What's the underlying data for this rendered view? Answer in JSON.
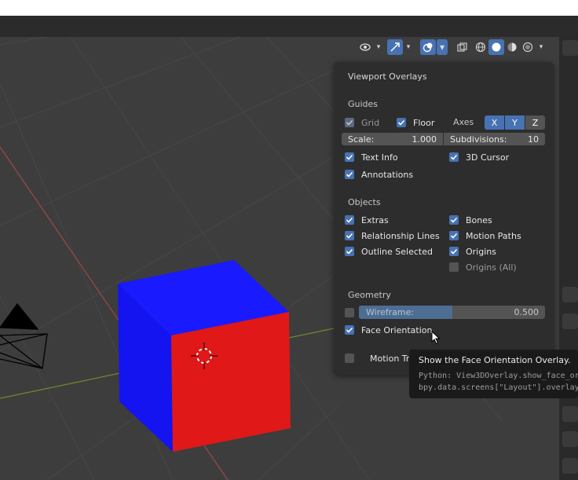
{
  "header": {
    "icons": [
      "eye-icon",
      "gizmo-icon",
      "overlays-icon",
      "xray-icon",
      "wireframe-shading-icon",
      "solid-shading-icon",
      "material-shading-icon",
      "rendered-shading-icon"
    ]
  },
  "panel": {
    "title": "Viewport Overlays",
    "guides": {
      "heading": "Guides",
      "grid": {
        "label": "Grid",
        "checked": true
      },
      "floor": {
        "label": "Floor",
        "checked": true
      },
      "axes_label": "Axes",
      "axes": [
        "X",
        "Y",
        "Z"
      ],
      "scale": {
        "label": "Scale:",
        "value": "1.000"
      },
      "subdivisions": {
        "label": "Subdivisions:",
        "value": "10"
      },
      "text_info": {
        "label": "Text Info",
        "checked": true
      },
      "cursor_3d": {
        "label": "3D Cursor",
        "checked": true
      },
      "annotations": {
        "label": "Annotations",
        "checked": true
      }
    },
    "objects": {
      "heading": "Objects",
      "extras": {
        "label": "Extras",
        "checked": true
      },
      "bones": {
        "label": "Bones",
        "checked": true
      },
      "relationship_lines": {
        "label": "Relationship Lines",
        "checked": true
      },
      "motion_paths": {
        "label": "Motion Paths",
        "checked": true
      },
      "outline_selected": {
        "label": "Outline Selected",
        "checked": true
      },
      "origins": {
        "label": "Origins",
        "checked": true
      },
      "origins_all": {
        "label": "Origins (All)",
        "checked": false
      }
    },
    "geometry": {
      "heading": "Geometry",
      "wireframe": {
        "label": "Wireframe:",
        "value": "0.500",
        "fraction": 0.5,
        "checked": false
      },
      "face_orientation": {
        "label": "Face Orientation",
        "checked": true
      }
    },
    "motion_tracking": {
      "label": "Motion Tra",
      "checked": false
    }
  },
  "tooltip": {
    "title": "Show the Face Orientation Overlay.",
    "python_line1": "Python: View3DOverlay.show_face_or",
    "python_line2": "bpy.data.screens[\"Layout\"].overlay"
  },
  "colors": {
    "accent": "#4772b3",
    "panel_bg": "#2d2d2d",
    "viewport_bg": "#3d3d3d",
    "cube_blue": "#1a1aff",
    "cube_red": "#e01818"
  }
}
